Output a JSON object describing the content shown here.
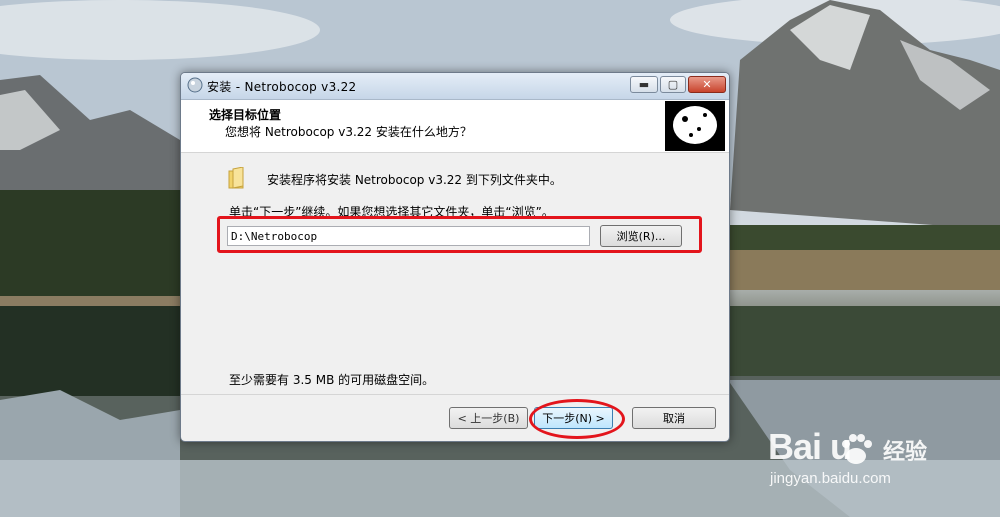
{
  "window": {
    "title": "安装 - Netrobocop v3.22",
    "min_symbol": "▬",
    "max_symbol": "▢",
    "close_symbol": "✕"
  },
  "header": {
    "title": "选择目标位置",
    "subtitle": "您想将 Netrobocop v3.22 安装在什么地方？"
  },
  "content": {
    "intro": "安装程序将安装 Netrobocop v3.22 到下列文件夹中。",
    "instruction": "单击“下一步”继续。如果您想选择其它文件夹，单击“浏览”。",
    "path_value": "D:\\Netrobocop",
    "browse_label": "浏览(R)...",
    "space_required": "至少需要有 3.5 MB 的可用磁盘空间。"
  },
  "footer": {
    "back_label": "< 上一步(B)",
    "next_label": "下一步(N) >",
    "cancel_label": "取消"
  },
  "watermark": {
    "logo_text": "Bai   u",
    "brand_cn": "经验",
    "url": "jingyan.baidu.com"
  },
  "colors": {
    "highlight": "#e3151c",
    "titlebar": "#c6d6e8",
    "dialog_bg": "#f0f0f0"
  },
  "icons": [
    "app-icon",
    "folder-icon",
    "installer-logo",
    "baidu-paw-icon"
  ]
}
